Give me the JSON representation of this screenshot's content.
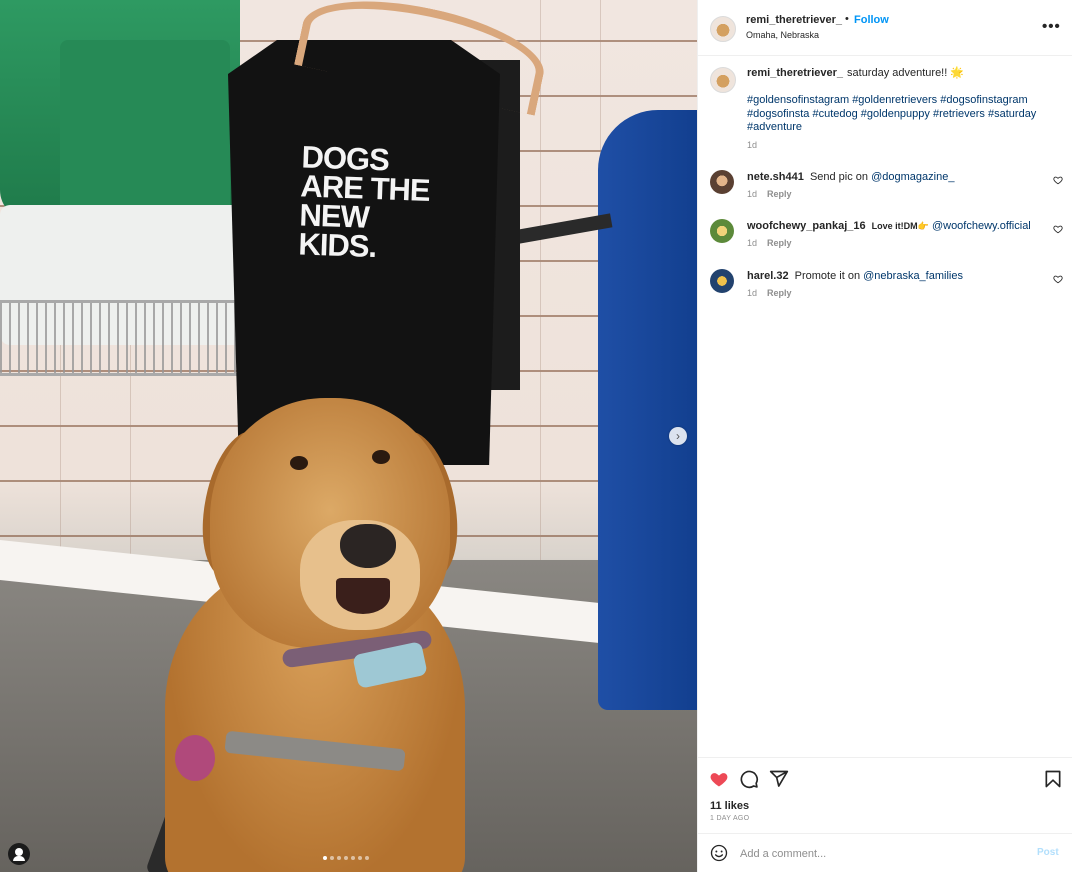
{
  "post": {
    "author": "remi_theretriever_",
    "separator": "•",
    "follow_label": "Follow",
    "location": "Omaha, Nebraska",
    "more_label": "•••",
    "caption_text": "saturday adventure!! 🌟",
    "hashtags": [
      "#goldensofinstagram",
      "#goldenretrievers",
      "#dogsofinstagram",
      "#dogsofinsta",
      "#cutedog",
      "#goldenpuppy",
      "#retrievers",
      "#saturday",
      "#adventure"
    ],
    "caption_time": "1d"
  },
  "photo": {
    "shirt_text": "DOGS\nARE THE\nNEW\nKIDS.",
    "next_label": "›",
    "carousel_index": 1,
    "carousel_count": 7
  },
  "comments": [
    {
      "user": "nete.sh441",
      "text": "Send pic on",
      "mention": "@dogmagazine_",
      "time": "1d",
      "reply": "Reply"
    },
    {
      "user": "woofchewy_pankaj_16",
      "text": "Love it!DM👉",
      "mention": "@woofchewy.official",
      "time": "1d",
      "reply": "Reply"
    },
    {
      "user": "harel.32",
      "text": "Promote it on",
      "mention": "@nebraska_families",
      "time": "1d",
      "reply": "Reply"
    }
  ],
  "stats": {
    "likes": "11 likes",
    "ago": "1 DAY AGO",
    "liked": true
  },
  "composer": {
    "placeholder": "Add a comment...",
    "post_label": "Post"
  },
  "colors": {
    "link": "#00376b",
    "accent": "#0095f6",
    "like": "#ed4956",
    "muted": "#8e8e8e"
  },
  "icons": [
    "tag-user-icon",
    "next-arrow-icon",
    "more-icon",
    "heart-icon",
    "comment-icon",
    "share-icon",
    "bookmark-icon",
    "emoji-icon"
  ]
}
